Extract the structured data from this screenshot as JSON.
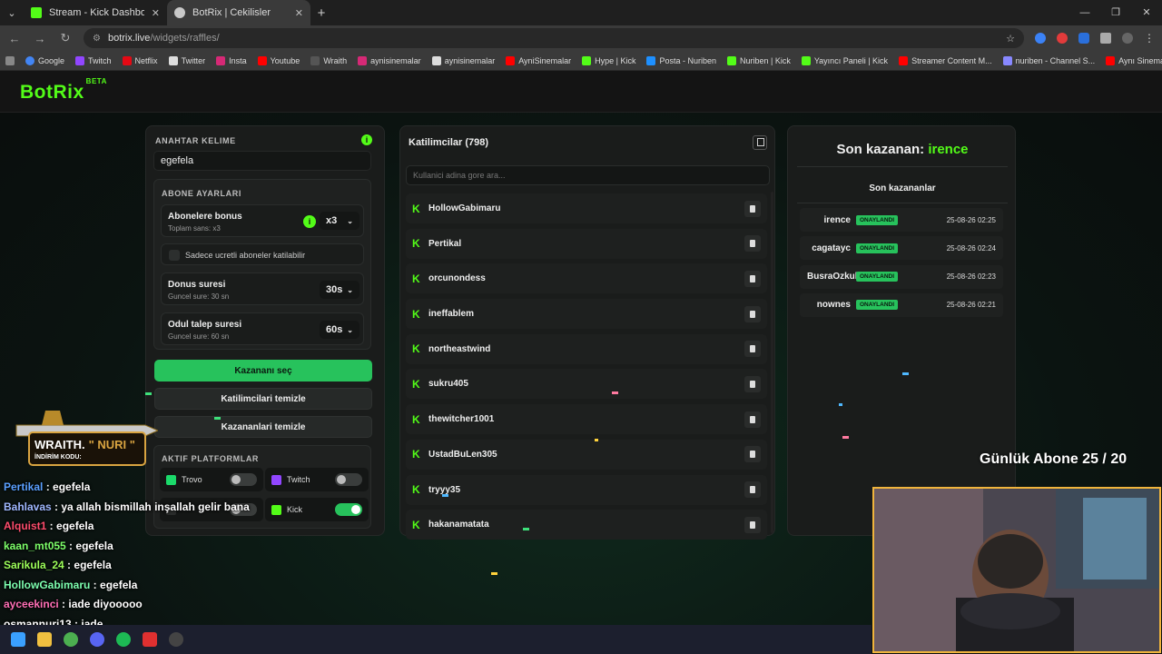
{
  "browser": {
    "tabs": [
      {
        "title": "Stream - Kick Dashboard",
        "active": false
      },
      {
        "title": "BotRix | Cekilisler",
        "active": true
      }
    ],
    "url_host": "botrix.live",
    "url_path": "/widgets/raffles/",
    "bookmarks": [
      "Google",
      "Twitch",
      "Netflix",
      "Twitter",
      "Insta",
      "Youtube",
      "Wraith",
      "aynisinemalar",
      "aynisinemalar",
      "AyniSinemalar",
      "Hype | Kick",
      "Posta - Nuriben",
      "Nuriben | Kick",
      "Yayıncı Paneli | Kick",
      "Streamer Content M...",
      "nuriben - Channel S...",
      "Aynı Sinemalar - Ça..."
    ]
  },
  "app": {
    "logo": "BotRix",
    "logo_tag": "BETA"
  },
  "settings": {
    "keyword_label": "ANAHTAR KELIME",
    "keyword_value": "egefela",
    "sub_settings_label": "ABONE AYARLARI",
    "sub_bonus_title": "Abonelere bonus",
    "sub_bonus_sub": "Toplam sans: x3",
    "sub_bonus_value": "x3",
    "paid_only_label": "Sadece ucretli aboneler katilabilir",
    "bonus_time_title": "Donus suresi",
    "bonus_time_sub": "Guncel sure: 30 sn",
    "bonus_time_value": "30s",
    "claim_time_title": "Odul talep suresi",
    "claim_time_sub": "Guncel sure: 60 sn",
    "claim_time_value": "60s",
    "pick_winner": "Kazananı seç",
    "clear_participants": "Katilimcilari temizle",
    "clear_winners": "Kazananlari temizle",
    "platforms_label": "AKTIF PLATFORMLAR",
    "platforms": [
      {
        "name": "Trovo",
        "on": false,
        "color": "#1bd96a"
      },
      {
        "name": "Twitch",
        "on": false,
        "color": "#9146ff"
      },
      {
        "name": "",
        "on": false,
        "color": "#1f2120"
      },
      {
        "name": "Kick",
        "on": true,
        "color": "#53fc18"
      }
    ]
  },
  "participants": {
    "title": "Katilimcilar (798)",
    "search_placeholder": "Kullanici adina gore ara...",
    "list": [
      "HollowGabimaru",
      "Pertikal",
      "orcunondess",
      "ineffablem",
      "northeastwind",
      "sukru405",
      "thewitcher1001",
      "UstadBuLen305",
      "tryyy35",
      "hakanamatata"
    ]
  },
  "winners": {
    "last_label": "Son kazanan:",
    "last_name": "irence",
    "recent_label": "Son kazananlar",
    "badge": "ONAYLANDI",
    "list": [
      {
        "name": "irence",
        "date": "25-08-26 02:25"
      },
      {
        "name": "cagatayc",
        "date": "25-08-26 02:24"
      },
      {
        "name": "BusraOzkul",
        "date": "25-08-26 02:23"
      },
      {
        "name": "nownes",
        "date": "25-08-26 02:21"
      }
    ]
  },
  "overlay": {
    "daily_subs": "Günlük Abone 25 / 20",
    "sponsor_brand": "WRAITH.",
    "sponsor_code_label": "İNDİRİM KODU:",
    "sponsor_code": "\" NURI \"",
    "chat": [
      {
        "user": "Pertikal",
        "msg": "egefela",
        "color": "#5aa0ff"
      },
      {
        "user": "Bahlavas",
        "msg": "ya allah bismillah inşallah gelir bana",
        "color": "#9fb8ff"
      },
      {
        "user": "Alquist1",
        "msg": "egefela",
        "color": "#ff4d6d"
      },
      {
        "user": "kaan_mt055",
        "msg": "egefela",
        "color": "#7dff6a"
      },
      {
        "user": "Sarikula_24",
        "msg": "egefela",
        "color": "#9dff5a"
      },
      {
        "user": "HollowGabimaru",
        "msg": "egefela",
        "color": "#7dffb0"
      },
      {
        "user": "ayceekinci",
        "msg": "iade diyooooo",
        "color": "#ff6fb5"
      },
      {
        "user": "osmannuri13",
        "msg": "iade",
        "color": "#ffffff"
      }
    ]
  }
}
